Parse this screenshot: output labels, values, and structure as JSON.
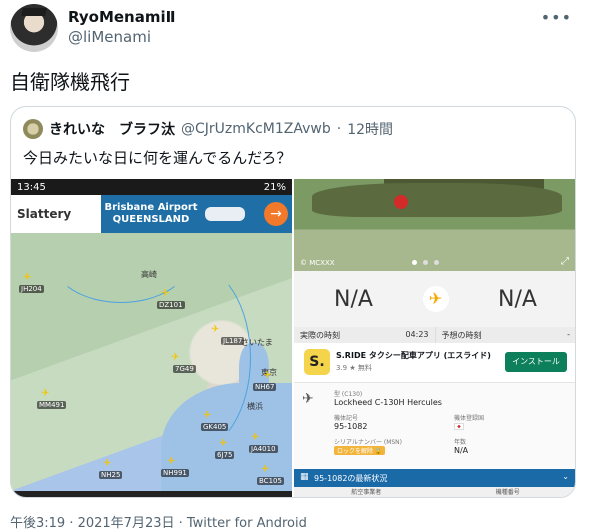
{
  "author": {
    "display_name": "RyoMenamiⅡ",
    "handle": "@liMenami"
  },
  "more_icon": "more-horizontal-icon",
  "tweet_text": "自衛隊機飛行",
  "quote": {
    "display_name": "きれいな　ブラフ汰",
    "handle": "@CJrUzmKcM1ZAvwb",
    "separator": "·",
    "time": "12時間",
    "text": "今日みたいな日に何を運んでるんだろ？"
  },
  "left_image": {
    "status_time": "13:45",
    "status_right": "21%",
    "ad_brand": "Slattery",
    "ad_title_line1": "Brisbane Airport",
    "ad_title_line2": "QUEENSLAND",
    "ad_arrow": "→",
    "flights": [
      "JH204",
      "DZ101",
      "JL187",
      "7G49",
      "MM491",
      "GK405",
      "JA4010",
      "NH25",
      "NH991",
      "BC105",
      "NH67",
      "6J75"
    ],
    "cities": [
      "高崎",
      "さいたま",
      "東京",
      "横浜"
    ]
  },
  "right_image": {
    "photo_credit": "© MCXXX",
    "route_left": "N/A",
    "route_right": "N/A",
    "actual_time_label": "実際の時刻",
    "actual_time_value": "04:23",
    "planned_time_label": "予想の時刻",
    "planned_time_value": "-",
    "app_name": "S.RIDE タクシー配車アプリ (エスライド)",
    "app_rating": "3.9 ★ 無料",
    "install_label": "インストール",
    "type_label": "型 (C130)",
    "type_value": "Lockheed C-130H Hercules",
    "reg_label": "機体記号",
    "reg_value": "95-1082",
    "country_label": "機体登録国",
    "serial_label": "シリアルナンバー (MSN)",
    "serial_tag": "ロックを解除 🔒",
    "age_label": "年数",
    "age_value": "N/A",
    "status_title": "95-1082の最新状況",
    "bottom_left": "航空事業者",
    "bottom_right": "機種番号"
  },
  "meta": "午後3:19 · 2021年7月23日 · Twitter for Android"
}
